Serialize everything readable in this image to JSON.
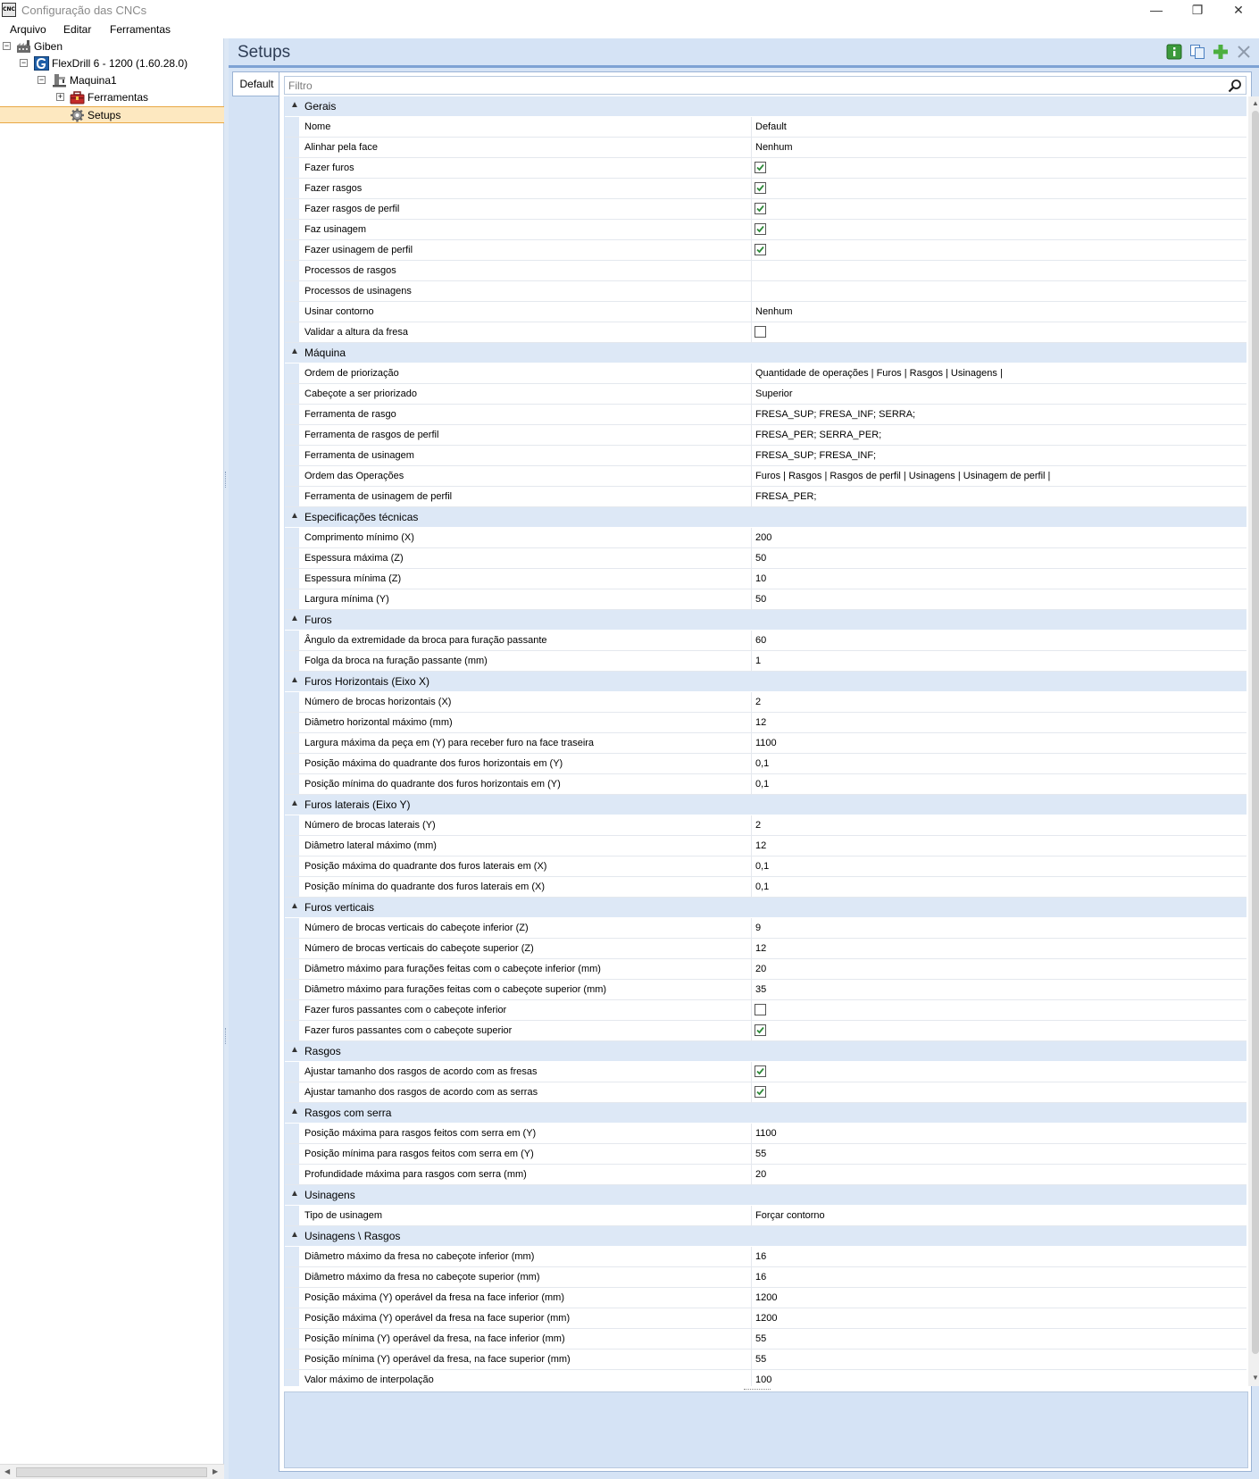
{
  "window": {
    "title": "Configuração das CNCs",
    "minimize_glyph": "—",
    "maximize_glyph": "❐",
    "close_glyph": "✕"
  },
  "menu": {
    "items": [
      "Arquivo",
      "Editar",
      "Ferramentas"
    ]
  },
  "tree": {
    "root": "Giben",
    "machine_model": "FlexDrill 6 - 1200 (1.60.28.0)",
    "machine": "Maquina1",
    "tools": "Ferramentas",
    "setups": "Setups",
    "collapse_glyph": "−",
    "expand_glyph": "+"
  },
  "main": {
    "title": "Setups",
    "tab_label": "Default",
    "filter_placeholder": "Filtro"
  },
  "colors": {
    "accent": "#7ea2d4",
    "category_background": "#dde8f6",
    "selection": "#fde8c0",
    "check": "#2f8a3a"
  },
  "icons": [
    "app-icon",
    "factory-icon",
    "machine-model-icon",
    "machine-icon",
    "toolbox-icon",
    "gear-icon",
    "info-icon",
    "copy-icon",
    "add-icon",
    "delete-icon",
    "search-icon",
    "checkbox-checked-icon"
  ],
  "categories": [
    {
      "name": "Gerais",
      "props": [
        {
          "label": "Nome",
          "value": "Default"
        },
        {
          "label": "Alinhar pela face",
          "value": "Nenhum"
        },
        {
          "label": "Fazer furos",
          "checked": true
        },
        {
          "label": "Fazer rasgos",
          "checked": true
        },
        {
          "label": "Fazer rasgos de perfil",
          "checked": true
        },
        {
          "label": "Faz usinagem",
          "checked": true
        },
        {
          "label": "Fazer usinagem de perfil",
          "checked": true
        },
        {
          "label": "Processos de rasgos",
          "value": ""
        },
        {
          "label": "Processos de usinagens",
          "value": ""
        },
        {
          "label": "Usinar contorno",
          "value": "Nenhum"
        },
        {
          "label": "Validar a altura da fresa",
          "checked": false
        }
      ]
    },
    {
      "name": "Máquina",
      "props": [
        {
          "label": "Ordem de priorização",
          "value": "Quantidade de operações | Furos | Rasgos | Usinagens |"
        },
        {
          "label": "Cabeçote a ser priorizado",
          "value": "Superior"
        },
        {
          "label": "Ferramenta de rasgo",
          "value": "FRESA_SUP; FRESA_INF; SERRA;"
        },
        {
          "label": "Ferramenta de rasgos de perfil",
          "value": "FRESA_PER; SERRA_PER;"
        },
        {
          "label": "Ferramenta de usinagem",
          "value": "FRESA_SUP; FRESA_INF;"
        },
        {
          "label": "Ordem das Operações",
          "value": "Furos | Rasgos | Rasgos de perfil | Usinagens | Usinagem de perfil |"
        },
        {
          "label": "Ferramenta de usinagem de perfil",
          "value": "FRESA_PER;"
        }
      ]
    },
    {
      "name": "Especificações técnicas",
      "props": [
        {
          "label": "Comprimento mínimo (X)",
          "value": "200"
        },
        {
          "label": "Espessura máxima (Z)",
          "value": "50"
        },
        {
          "label": "Espessura mínima (Z)",
          "value": "10"
        },
        {
          "label": "Largura mínima (Y)",
          "value": "50"
        }
      ]
    },
    {
      "name": "Furos",
      "props": [
        {
          "label": "Ângulo da extremidade da broca para furação passante",
          "value": "60"
        },
        {
          "label": "Folga da broca na furação passante (mm)",
          "value": "1"
        }
      ]
    },
    {
      "name": "Furos Horizontais (Eixo X)",
      "props": [
        {
          "label": "Número de brocas horizontais (X)",
          "value": "2"
        },
        {
          "label": "Diâmetro horizontal máximo (mm)",
          "value": "12"
        },
        {
          "label": "Largura máxima da peça em (Y) para receber furo na face traseira",
          "value": "1100"
        },
        {
          "label": "Posição máxima do quadrante dos furos horizontais em (Y)",
          "value": "0,1"
        },
        {
          "label": "Posição mínima do quadrante dos furos horizontais em (Y)",
          "value": "0,1"
        }
      ]
    },
    {
      "name": "Furos laterais (Eixo Y)",
      "props": [
        {
          "label": "Número de brocas laterais (Y)",
          "value": "2"
        },
        {
          "label": "Diâmetro lateral máximo (mm)",
          "value": "12"
        },
        {
          "label": "Posição máxima do quadrante dos furos laterais em (X)",
          "value": "0,1"
        },
        {
          "label": "Posição mínima do quadrante dos furos laterais em (X)",
          "value": "0,1"
        }
      ]
    },
    {
      "name": "Furos verticais",
      "props": [
        {
          "label": "Número de brocas verticais do cabeçote inferior (Z)",
          "value": "9"
        },
        {
          "label": "Número de brocas verticais do cabeçote superior (Z)",
          "value": "12"
        },
        {
          "label": "Diâmetro máximo para furações feitas com o cabeçote inferior (mm)",
          "value": "20"
        },
        {
          "label": "Diâmetro máximo para furações feitas com o cabeçote superior (mm)",
          "value": "35"
        },
        {
          "label": "Fazer furos passantes com o cabeçote inferior",
          "checked": false
        },
        {
          "label": "Fazer furos passantes com o cabeçote superior",
          "checked": true
        }
      ]
    },
    {
      "name": "Rasgos",
      "props": [
        {
          "label": "Ajustar tamanho dos rasgos de acordo com as fresas",
          "checked": true
        },
        {
          "label": "Ajustar tamanho dos rasgos de acordo com as serras",
          "checked": true
        }
      ]
    },
    {
      "name": "Rasgos com serra",
      "props": [
        {
          "label": "Posição máxima para rasgos feitos com serra em (Y)",
          "value": "1100"
        },
        {
          "label": "Posição mínima para rasgos feitos com serra em (Y)",
          "value": "55"
        },
        {
          "label": "Profundidade máxima para rasgos com serra (mm)",
          "value": "20"
        }
      ]
    },
    {
      "name": "Usinagens",
      "props": [
        {
          "label": "Tipo de usinagem",
          "value": "Forçar contorno"
        }
      ]
    },
    {
      "name": "Usinagens \\ Rasgos",
      "props": [
        {
          "label": "Diâmetro máximo da fresa no cabeçote inferior (mm)",
          "value": "16"
        },
        {
          "label": "Diâmetro máximo da fresa no cabeçote superior (mm)",
          "value": "16"
        },
        {
          "label": "Posição máxima (Y) operável da fresa na face inferior (mm)",
          "value": "1200"
        },
        {
          "label": "Posição máxima (Y) operável da fresa na face superior (mm)",
          "value": "1200"
        },
        {
          "label": "Posição mínima (Y) operável da fresa, na face inferior (mm)",
          "value": "55"
        },
        {
          "label": "Posição mínima (Y) operável da fresa, na face superior (mm)",
          "value": "55"
        },
        {
          "label": "Valor máximo de interpolação",
          "value": "100"
        }
      ]
    }
  ]
}
